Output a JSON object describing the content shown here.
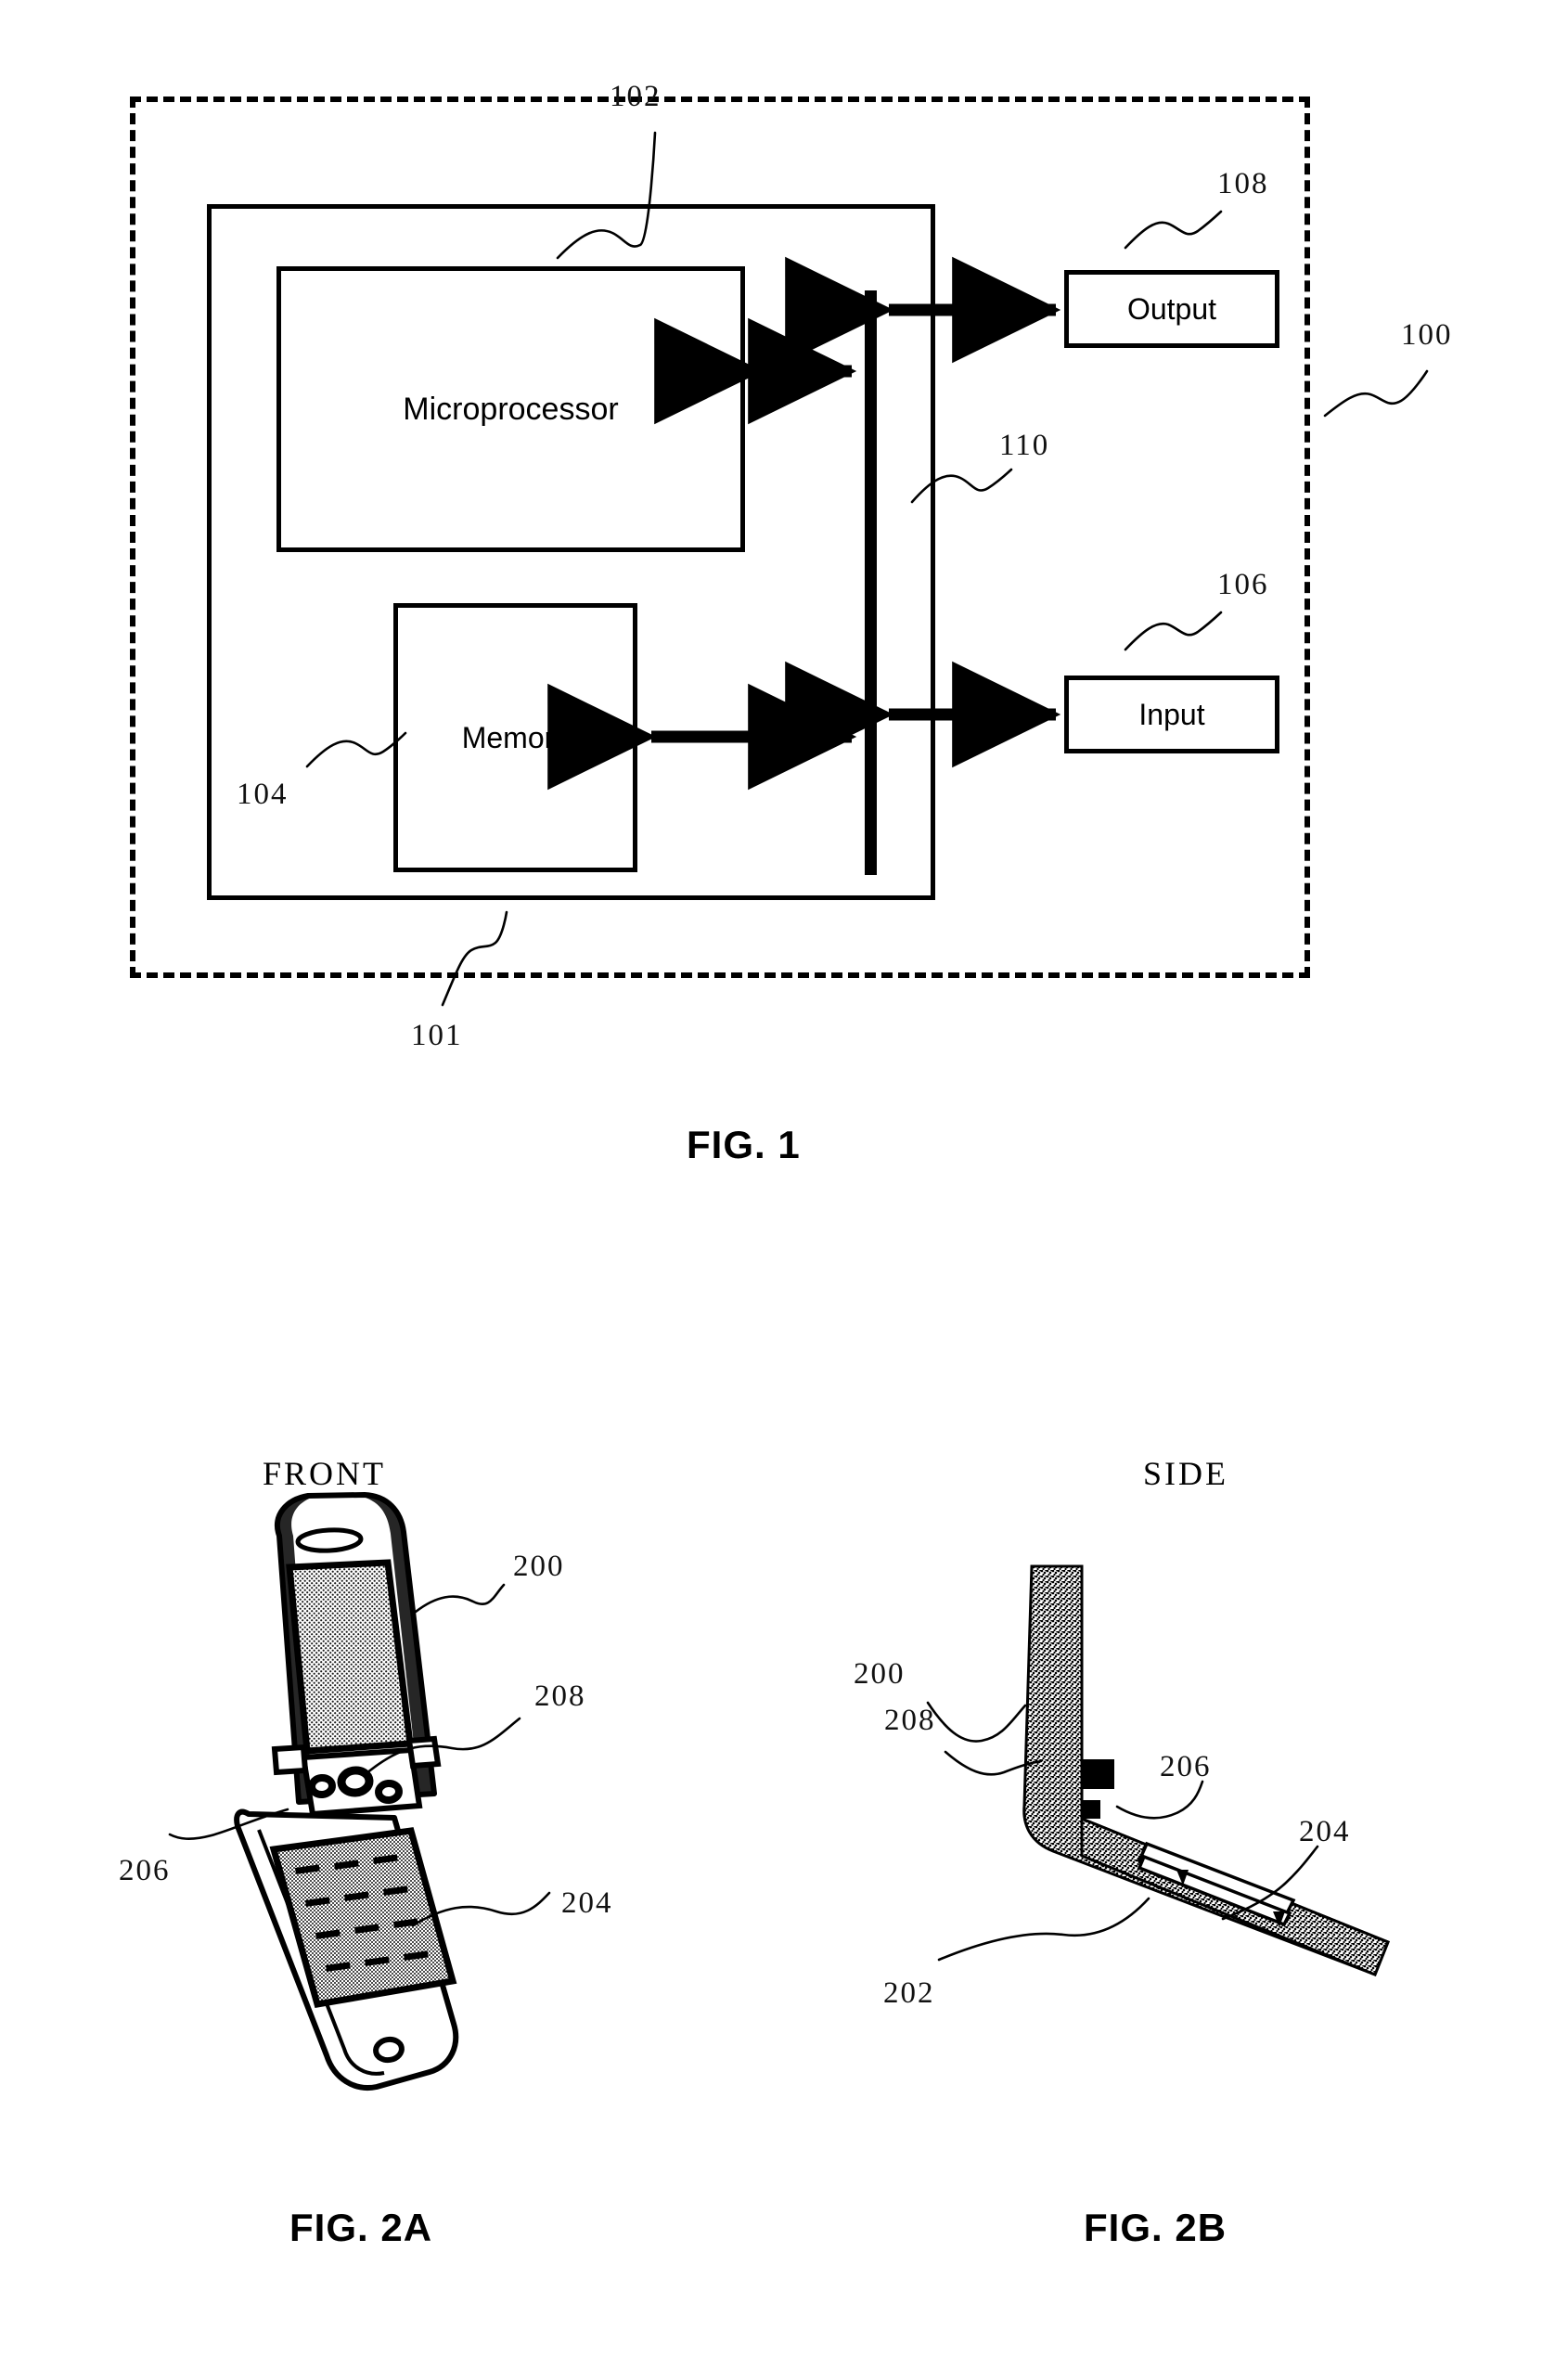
{
  "document": {
    "type": "patent-drawing-sheet",
    "figures": [
      "FIG. 1",
      "FIG. 2A",
      "FIG. 2B"
    ]
  },
  "figure1": {
    "caption": "FIG. 1",
    "blocks": {
      "microprocessor": "Microprocessor",
      "memory": "Memory",
      "output": "Output",
      "input": "Input"
    },
    "refs": {
      "system": "100",
      "dashed_boundary": "101",
      "device_housing": "102",
      "memory_ref": "104",
      "input_ref": "106",
      "output_ref": "108",
      "bus_ref": "110"
    }
  },
  "figure2a": {
    "caption": "FIG. 2A",
    "view_title": "FRONT",
    "refs": {
      "phone": "200",
      "keypad": "204",
      "lower_element": "206",
      "hinge_element": "208"
    }
  },
  "figure2b": {
    "caption": "FIG. 2B",
    "view_title": "SIDE",
    "refs": {
      "phone": "200",
      "base": "202",
      "strip": "204",
      "contact": "206",
      "upper_body": "208"
    }
  }
}
